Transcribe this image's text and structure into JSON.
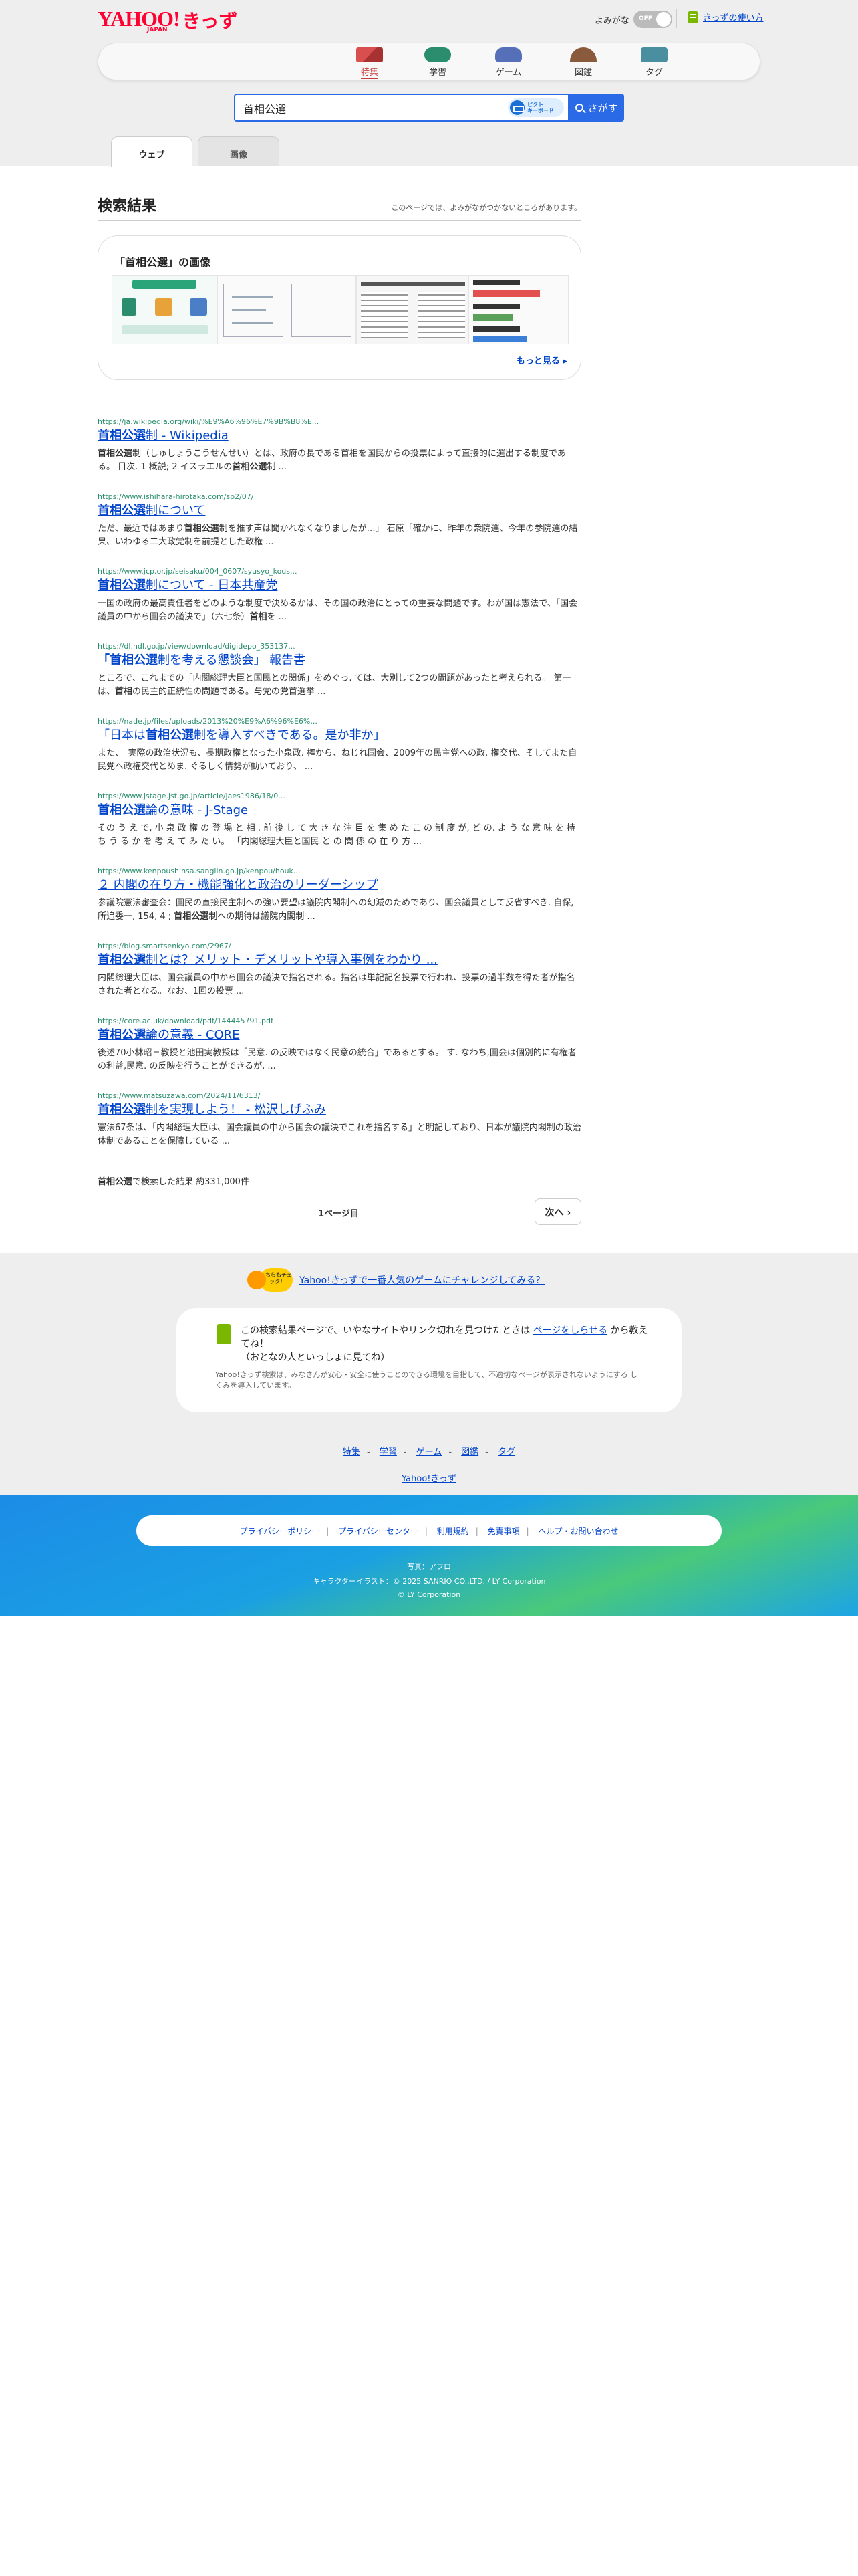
{
  "header": {
    "logo_main": "YAHOO!",
    "logo_sub": "JAPAN",
    "logo_kids": "きっず",
    "yomigana_label": "よみがな",
    "yomigana_toggle": "OFF",
    "howto_label": "きっずの使い方"
  },
  "nav": [
    {
      "label": "特集",
      "icon": "tokushu-icon"
    },
    {
      "label": "学習",
      "icon": "gakushu-icon"
    },
    {
      "label": "ゲーム",
      "icon": "game-icon"
    },
    {
      "label": "図鑑",
      "icon": "zukan-icon"
    },
    {
      "label": "タグ",
      "icon": "tag-icon"
    }
  ],
  "search": {
    "query": "首相公選",
    "pict_keyboard_line1": "ピクト",
    "pict_keyboard_line2": "キーボード",
    "button_label": "さがす"
  },
  "tabs": [
    {
      "label": "ウェブ",
      "active": true
    },
    {
      "label": "画像",
      "active": false
    }
  ],
  "results_header": {
    "title": "検索結果",
    "note": "このページでは、よみがながつかないところがあります。"
  },
  "image_panel": {
    "title": "「首相公選」の画像",
    "more_link": "もっと見る"
  },
  "results": [
    {
      "url": "https://ja.wikipedia.org/wiki/%E9%A6%96%E7%9B%B8%E...",
      "title_bold": "首相公選",
      "title_rest": "制 - Wikipedia",
      "desc_html": "<b>首相公選</b>制（しゅしょうこうせんせい）とは、政府の長である首相を国民からの投票によって直接的に選出する制度である。 目次. 1 概説; 2 イスラエルの<b>首相公選</b>制 ..."
    },
    {
      "url": "https://www.ishihara-hirotaka.com/sp2/07/",
      "title_bold": "首相公選",
      "title_rest": "制について",
      "desc_html": "ただ、最近ではあまり<b>首相公選</b>制を推す声は聞かれなくなりましたが…」 石原「確かに、昨年の衆院選、今年の参院選の結果、いわゆる二大政党制を前提とした政権 ..."
    },
    {
      "url": "https://www.jcp.or.jp/seisaku/004_0607/syusyo_kous...",
      "title_bold": "首相公選",
      "title_rest": "制について - 日本共産党",
      "desc_html": "一国の政府の最高責任者をどのような制度で決めるかは、その国の政治にとっての重要な問題です。わが国は憲法で、「国会議員の中から国会の議決で」（六七条）<b>首相</b>を ..."
    },
    {
      "url": "https://dl.ndl.go.jp/view/download/digidepo_353137...",
      "title_bold": "「首相公選",
      "title_rest": "制を考える懇談会」 報告書",
      "desc_html": "ところで、これまでの「内閣総理大臣と国民との関係」をめぐっ. ては、大別して2つの問題があったと考えられる。 第一は、<b>首相</b>の民主的正統性の問題である。与党の党首選挙 ..."
    },
    {
      "url": "https://nade.jp/files/uploads/2013%20%E9%A6%96%E6%...",
      "title_pre": "「日本は",
      "title_bold": "首相公選",
      "title_rest": "制を導入すべきである。是か非か」",
      "desc_html": "また、　実際の政治状況も、長期政権となった小泉政. 権から、ねじれ国会、2009年の民主党への政. 権交代、そしてまた自民党へ政権交代とめま. ぐるしく情勢が動いており、 ..."
    },
    {
      "url": "https://www.jstage.jst.go.jp/article/jaes1986/18/0...",
      "title_bold": "首相公選",
      "title_rest": "論の意味 - J-Stage",
      "desc_html": "その う え で, 小 泉 政 権 の 登 場 と 相 . 前 後 し て 大 き な 注 目 を 集 め た こ の 制 度 が, ど の. よ う な 意 味 を 持 ち う る か を 考 え て み た い。 「内閣総理大臣と国民 と の 関 係 の 在 り 方 ..."
    },
    {
      "url": "https://www.kenpoushinsa.sangiin.go.jp/kenpou/houk...",
      "title_bold": "",
      "title_rest": "２ 内閣の在り方・機能強化と政治のリーダーシップ",
      "desc_html": "参議院憲法審査会：国民の直接民主制への強い要望は議院内閣制への幻滅のためであり、国会議員として反省すべき. 自保, 所追委一, 154, 4 ; <b>首相公選</b>制への期待は議院内閣制 ..."
    },
    {
      "url": "https://blog.smartsenkyo.com/2967/",
      "title_bold": "首相公選",
      "title_rest": "制とは？メリット・デメリットや導入事例をわかり ...",
      "desc_html": "内閣総理大臣は、国会議員の中から国会の議決で指名される。指名は単記記名投票で行われ、投票の過半数を得た者が指名された者となる。なお、1回の投票 ..."
    },
    {
      "url": "https://core.ac.uk/download/pdf/144445791.pdf",
      "title_bold": "首相公選",
      "title_rest": "論の意義 - CORE",
      "desc_html": "後述70小林昭三教授と池田実教授は「民意. の反映ではなく民意の統合」であるとする。 す. なわち,国会は個別的に有権者の利益,民意. の反映を行うことができるが, ..."
    },
    {
      "url": "https://www.matsuzawa.com/2024/11/6313/",
      "title_bold": "首相公選",
      "title_rest": "制を実現しよう！ - 松沢しげふみ",
      "desc_html": "憲法67条は、「内閣総理大臣は、国会議員の中から国会の議決でこれを指名する」と明記しており、日本が議院内閣制の政治体制であることを保障している ..."
    }
  ],
  "count": {
    "query_bold": "首相公選",
    "text": "で検索した結果 約331,000件"
  },
  "pagination": {
    "page_label": "1ページ目",
    "next_label": "次へ"
  },
  "promo": {
    "badge": "こちらもチェック!",
    "link": "Yahoo!きっずで一番人気のゲームにチャレンジしてみる？"
  },
  "report": {
    "text_a": "この検索結果ページで、いやなサイトやリンク切れを見つけたときは ",
    "link": "ページをしらせる",
    "text_b": " から教えてね！",
    "text_c": "（おとなの人といっしょに見てね）",
    "note": "Yahoo!きっず検索は、みなさんが安心・安全に使うことのできる環境を目指して、不適切なページが表示されないようにする しくみを導入しています。"
  },
  "footer_nav": {
    "items": [
      "特集",
      "学習",
      "ゲーム",
      "図鑑",
      "タグ"
    ],
    "kids_link": "Yahoo!きっず"
  },
  "bottom": {
    "links": [
      "プライバシーポリシー",
      "プライバシーセンター",
      "利用規約",
      "免責事項",
      "ヘルプ・お問い合わせ"
    ],
    "credit_photo": "写真：アフロ",
    "credit_character": "キャラクターイラスト：© 2025 SANRIO CO.,LTD. / LY Corporation",
    "copyright": "© LY Corporation"
  }
}
